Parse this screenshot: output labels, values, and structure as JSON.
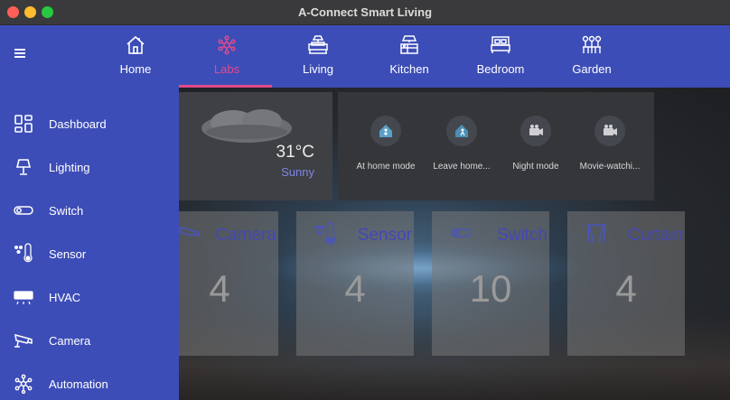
{
  "window": {
    "title": "A-Connect Smart Living"
  },
  "tabs": [
    {
      "label": "Home",
      "icon": "home-icon"
    },
    {
      "label": "Labs",
      "icon": "labs-icon",
      "active": true
    },
    {
      "label": "Living",
      "icon": "living-room-icon"
    },
    {
      "label": "Kitchen",
      "icon": "kitchen-icon"
    },
    {
      "label": "Bedroom",
      "icon": "bed-icon"
    },
    {
      "label": "Garden",
      "icon": "garden-icon"
    }
  ],
  "sidebar": {
    "items": [
      {
        "label": "Dashboard",
        "icon": "dashboard-icon"
      },
      {
        "label": "Lighting",
        "icon": "lamp-icon"
      },
      {
        "label": "Switch",
        "icon": "toggle-icon"
      },
      {
        "label": "Sensor",
        "icon": "sensor-icon"
      },
      {
        "label": "HVAC",
        "icon": "hvac-icon"
      },
      {
        "label": "Camera",
        "icon": "camera-icon"
      },
      {
        "label": "Automation",
        "icon": "automation-icon"
      }
    ]
  },
  "weather": {
    "temperature": "31°C",
    "condition": "Sunny",
    "icon": "cloud-icon"
  },
  "modes": [
    {
      "label": "At home mode",
      "icon": "home-person-icon"
    },
    {
      "label": "Leave home...",
      "icon": "leave-home-icon"
    },
    {
      "label": "Night mode",
      "icon": "night-camera-icon"
    },
    {
      "label": "Movie-watchi...",
      "icon": "movie-camera-icon"
    }
  ],
  "devices": [
    {
      "title": "Camera",
      "count": "4",
      "icon": "camera-icon"
    },
    {
      "title": "Sensor",
      "count": "4",
      "icon": "sensor-icon"
    },
    {
      "title": "Switch",
      "count": "10",
      "icon": "toggle-icon"
    },
    {
      "title": "Curtain",
      "count": "4",
      "icon": "curtain-icon"
    }
  ],
  "colors": {
    "primary": "#3d4db7",
    "accent": "#e24a8b",
    "muted_text": "#4447b8",
    "weather_condition": "#7f86e6"
  }
}
